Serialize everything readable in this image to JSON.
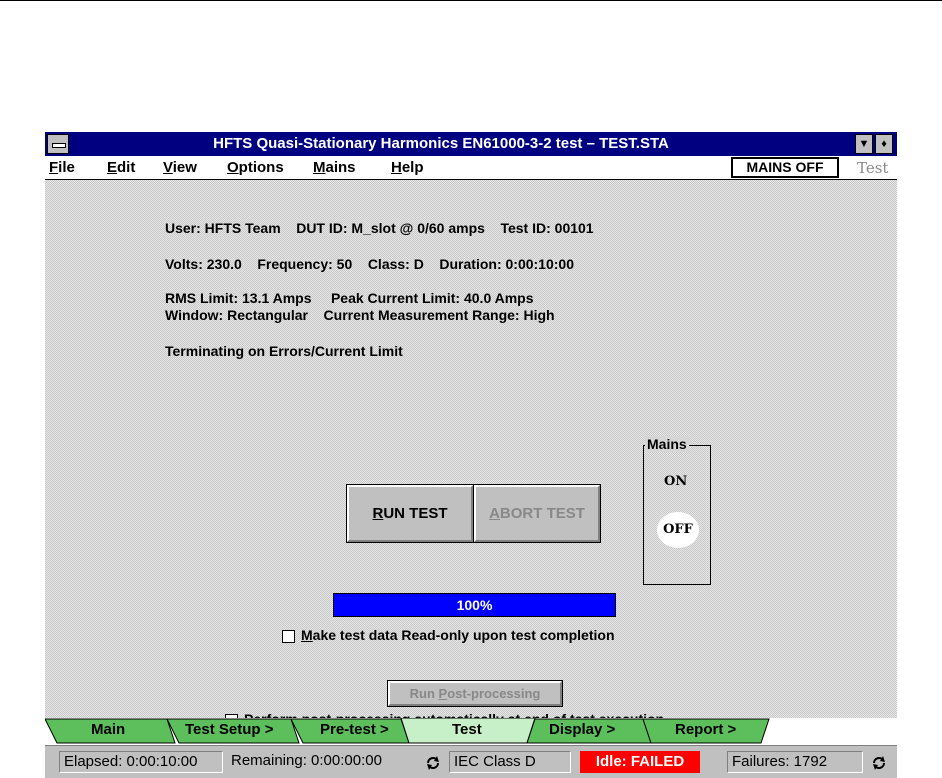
{
  "window": {
    "title": "HFTS Quasi-Stationary Harmonics EN61000-3-2 test – TEST.STA",
    "down_arrow": "▼",
    "restore_arrows": "♦"
  },
  "menu": {
    "items": [
      {
        "key": "F",
        "rest": "ile"
      },
      {
        "key": "E",
        "rest": "dit"
      },
      {
        "key": "V",
        "rest": "iew"
      },
      {
        "key": "O",
        "rest": "ptions"
      },
      {
        "key": "M",
        "rest": "ains"
      },
      {
        "key": "H",
        "rest": "elp"
      }
    ],
    "mains_off": "MAINS OFF",
    "test": "Test"
  },
  "info": {
    "user_line": "User: HFTS Team    DUT ID: M_slot @ 0/60 amps    Test ID: 00101",
    "volts_line": "Volts: 230.0    Frequency: 50    Class: D    Duration: 0:00:10:00",
    "limit_line": "RMS Limit: 13.1 Amps     Peak Current Limit: 40.0 Amps",
    "window_line": "Window: Rectangular    Current Measurement Range: High",
    "terminating": "Terminating on Errors/Current Limit"
  },
  "buttons": {
    "run_test_key": "R",
    "run_test_rest": "UN TEST",
    "abort_test_key": "A",
    "abort_test_rest": "BORT TEST",
    "run_post_pre": "Run ",
    "run_post_key": "P",
    "run_post_rest": "ost-processing"
  },
  "progress": {
    "label": "100%",
    "value": 1.0
  },
  "checkboxes": {
    "readonly_key": "M",
    "readonly_rest": "ake test data Read-only upon test completion",
    "postproc_key": "P",
    "postproc_rest": "erform post-processing automatically at end of test execution"
  },
  "mains": {
    "title": "Mains",
    "on": "ON",
    "off": "OFF"
  },
  "tabs": {
    "items": [
      "Main",
      "Test Setup >",
      "Pre-test >",
      "Test",
      "Display >",
      "Report >"
    ],
    "active": "Test"
  },
  "status": {
    "elapsed": "Elapsed: 0:00:10:00",
    "remaining": "Remaining: 0:00:00:00",
    "iec_class": "IEC Class D",
    "state": "Idle: FAILED",
    "failures": "Failures: 1792"
  },
  "colors": {
    "titlebar": "#000080",
    "progress": "#0000ff",
    "failed": "#ff0000",
    "tab_green": "#5cbf5c",
    "tab_active": "#c8f0c8"
  }
}
